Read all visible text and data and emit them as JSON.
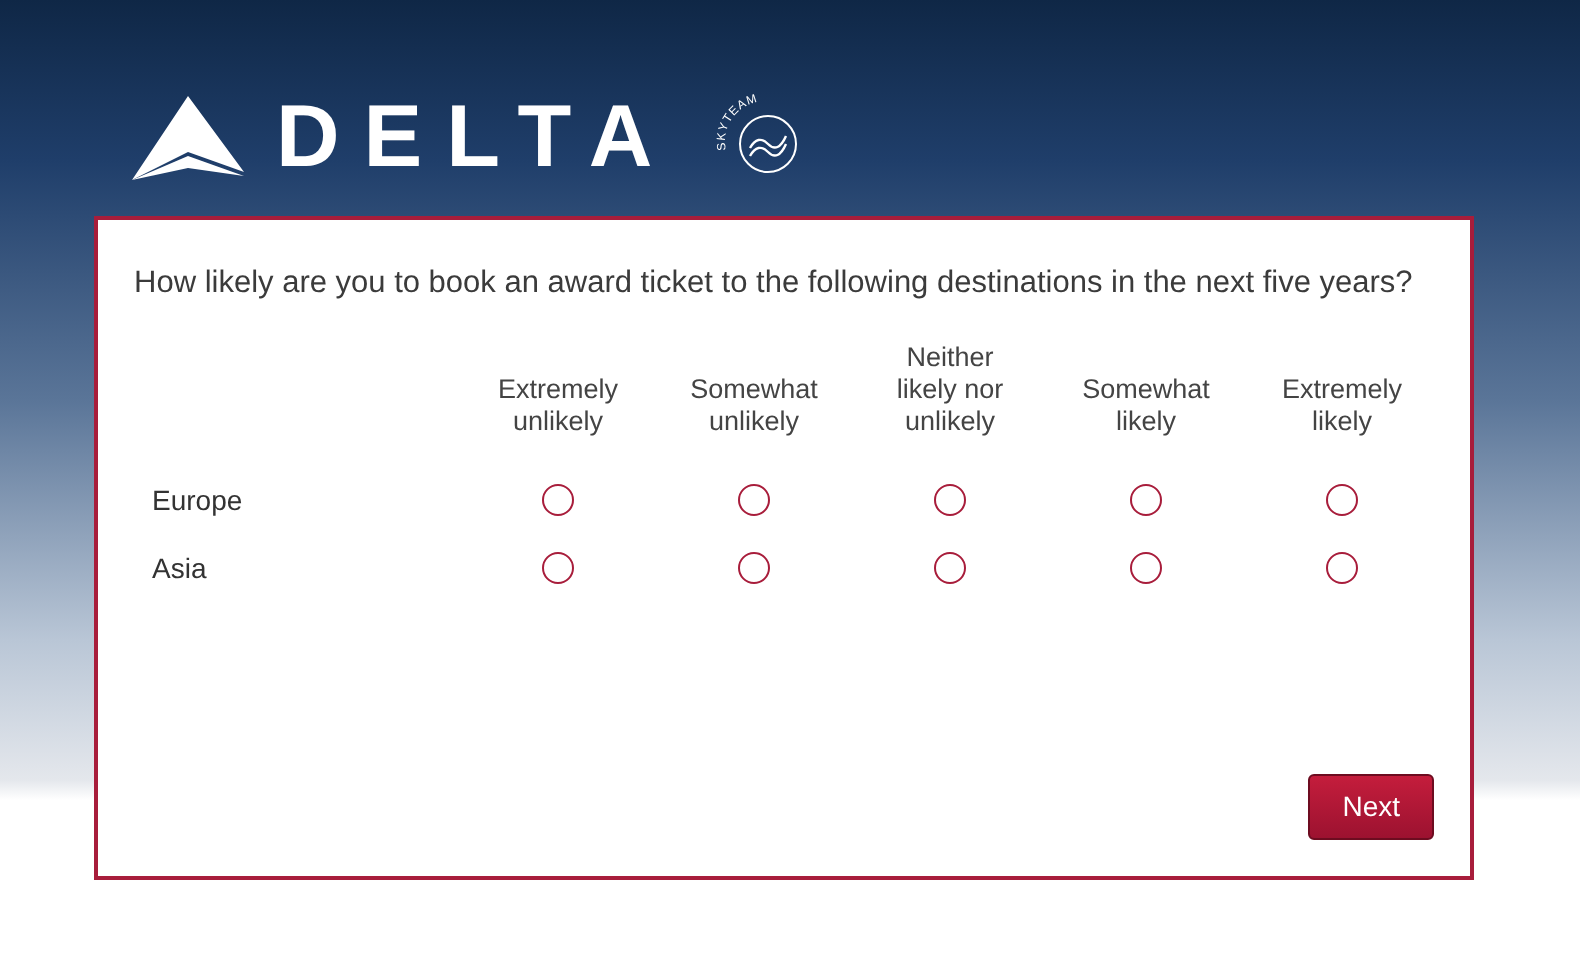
{
  "brand": {
    "name": "DELTA",
    "alliance": "SKYTEAM"
  },
  "question": "How likely are you to book an award ticket to the following destinations in the next five years?",
  "scale": [
    "Extremely unlikely",
    "Somewhat unlikely",
    "Neither likely nor unlikely",
    "Somewhat likely",
    "Extremely likely"
  ],
  "rows": [
    {
      "label": "Europe",
      "options": [
        {
          "selected": false
        },
        {
          "selected": false
        },
        {
          "selected": false
        },
        {
          "selected": false
        },
        {
          "selected": false
        }
      ]
    },
    {
      "label": "Asia",
      "options": [
        {
          "selected": false
        },
        {
          "selected": false
        },
        {
          "selected": false
        },
        {
          "selected": false
        },
        {
          "selected": false
        }
      ]
    }
  ],
  "buttons": [
    {
      "label": "Next"
    }
  ]
}
